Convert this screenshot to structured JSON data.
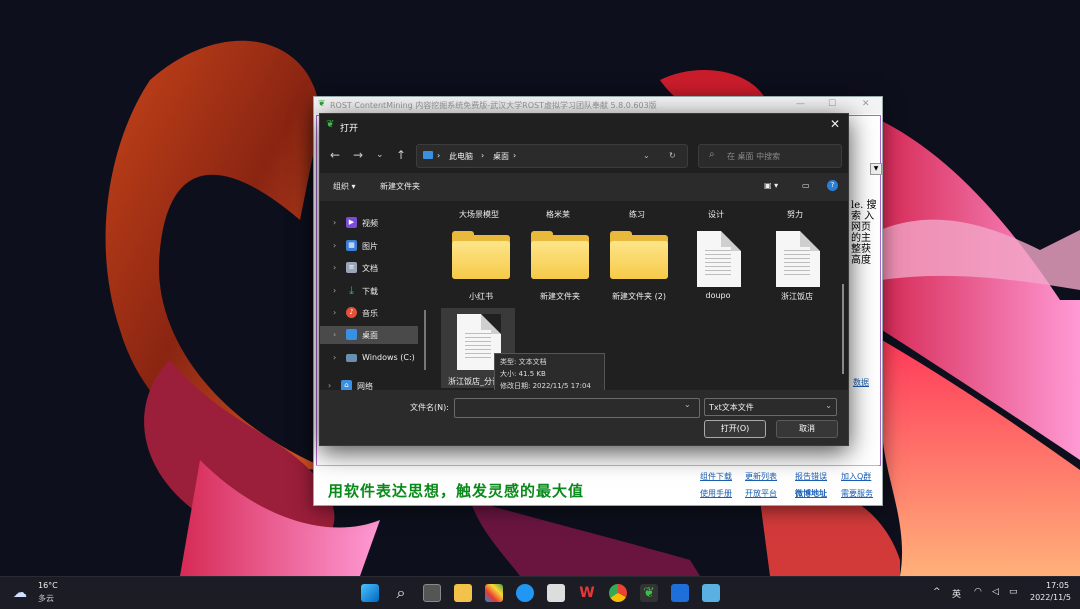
{
  "host_window": {
    "title": "ROST ContentMining 内容挖掘系统免费版-武汉大学ROST虚拟学习团队奉献 5.8.0.603版",
    "side_text": "le. 搜索 入 网页 的主 整获 高度",
    "scroll_button": "▼",
    "data_link": "数据",
    "slogan": "用软件表达思想，触发灵感的最大值",
    "links": {
      "download": "组件下载",
      "updates": "更新列表",
      "report": "报告错误",
      "join_qq": "加入Q群",
      "manual": "使用手册",
      "dev_platform": "开放平台",
      "weibo": "微博地址",
      "services": "需要服务"
    }
  },
  "dialog": {
    "title": "打开",
    "close_icon": "✕",
    "address": [
      "此电脑",
      "桌面"
    ],
    "search_placeholder": "在 桌面 中搜索",
    "organize": "组织 ▾",
    "new_folder": "新建文件夹",
    "nav": [
      {
        "label": "视频",
        "icon": "video-icon",
        "color": "#7a4cd8"
      },
      {
        "label": "图片",
        "icon": "pictures-icon",
        "color": "#3b7fd6"
      },
      {
        "label": "文档",
        "icon": "documents-icon",
        "color": "#9aa6b8"
      },
      {
        "label": "下载",
        "icon": "downloads-icon",
        "color": "#2bb673"
      },
      {
        "label": "音乐",
        "icon": "music-icon",
        "color": "#e0523a"
      },
      {
        "label": "桌面",
        "icon": "desktop-icon",
        "color": "#3b8fe0"
      },
      {
        "label": "Windows (C:)",
        "icon": "drive-icon",
        "color": "#6b8fb0"
      },
      {
        "label": "网络",
        "icon": "network-icon",
        "color": "#3b8fe0"
      }
    ],
    "top_row_labels": [
      "大场景模型",
      "格米莱",
      "练习",
      "设计",
      "努力"
    ],
    "tiles": [
      {
        "label": "小红书",
        "kind": "folder"
      },
      {
        "label": "新建文件夹",
        "kind": "folder"
      },
      {
        "label": "新建文件夹 (2)",
        "kind": "folder"
      },
      {
        "label": "doupo",
        "kind": "document"
      },
      {
        "label": "浙江饭店",
        "kind": "document"
      },
      {
        "label": "浙江饭店_分词后",
        "kind": "document"
      }
    ],
    "tooltip": {
      "type": "类型: 文本文档",
      "size": "大小: 41.5 KB",
      "date": "修改日期: 2022/11/5 17:04"
    },
    "filename_label": "文件名(N):",
    "filename_value": "",
    "filetype": "Txt文本文件",
    "open_button": "打开(O)",
    "cancel_button": "取消"
  },
  "taskbar": {
    "weather_temp": "16°C",
    "weather_desc": "多云",
    "ime": "英",
    "time": "17:05",
    "date": "2022/11/5"
  }
}
